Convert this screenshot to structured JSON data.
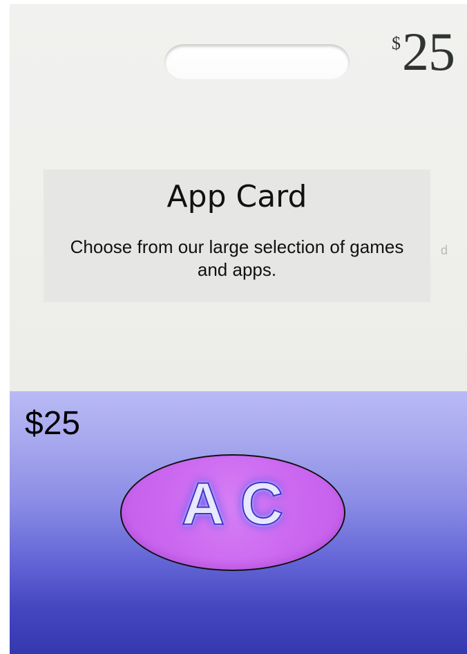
{
  "card": {
    "top_price": {
      "currency": "$",
      "amount": "25"
    },
    "label": {
      "title": "App Card",
      "subtitle": "Choose from our large selection of games and apps."
    },
    "background_fragment": "d",
    "bottom_price": "$25",
    "logo_text": "A C"
  },
  "colors": {
    "card_top": "#efefec",
    "label_panel": "#e6e6e4",
    "gradient_top": "#b8b9f4",
    "gradient_bottom": "#3537af",
    "logo_fill": "#cb68f0",
    "logo_glow": "#5f55ea"
  }
}
